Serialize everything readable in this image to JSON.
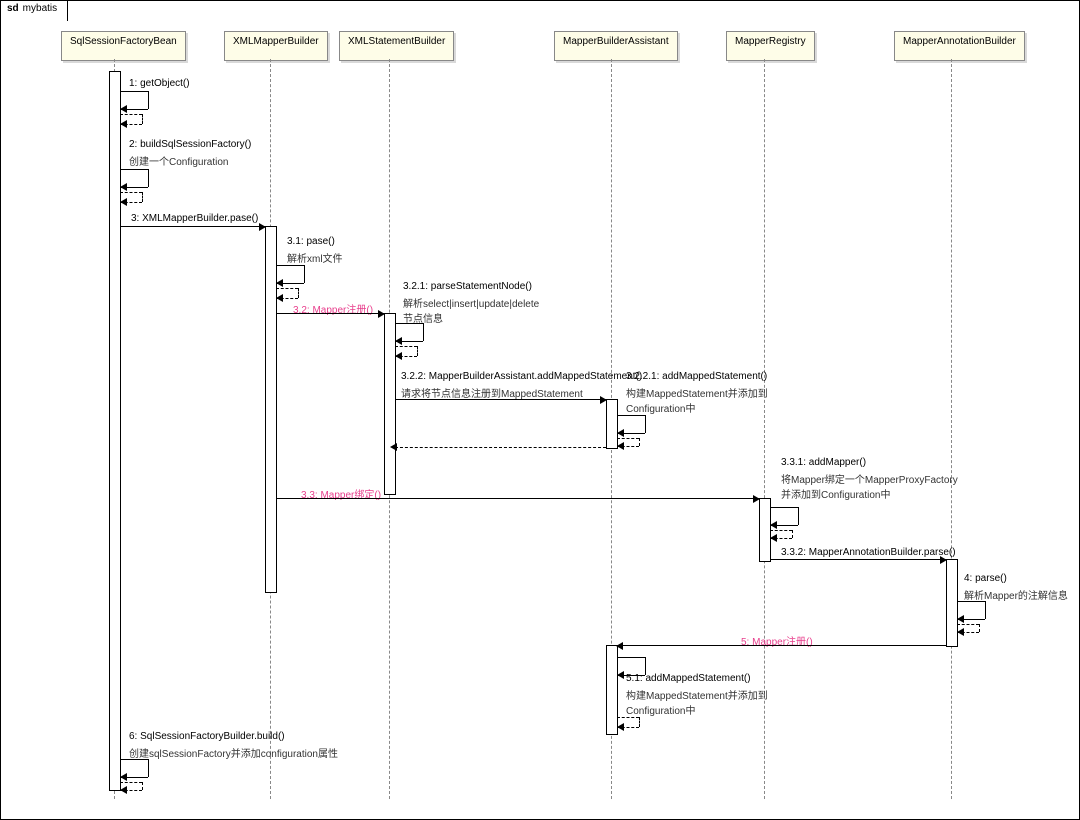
{
  "diagram": {
    "frame_kind": "sd",
    "frame_name": "mybatis",
    "participants": {
      "p1": "SqlSessionFactoryBean",
      "p2": "XMLMapperBuilder",
      "p3": "XMLStatementBuilder",
      "p4": "MapperBuilderAssistant",
      "p5": "MapperRegistry",
      "p6": "MapperAnnotationBuilder"
    },
    "messages": {
      "m1": "1: getObject()",
      "m2": "2: buildSqlSessionFactory()",
      "m2n": "创建一个Configuration",
      "m3": "3: XMLMapperBuilder.pase()",
      "m3_1": "3.1: pase()",
      "m3_1n": "解析xml文件",
      "m3_2": "3.2: Mapper注册()",
      "m3_2_1": "3.2.1: parseStatementNode()",
      "m3_2_1n": "解析select|insert|update|delete\n节点信息",
      "m3_2_2": "3.2.2: MapperBuilderAssistant.addMappedStatement()",
      "m3_2_2n": "请求将节点信息注册到MappedStatement",
      "m3_2_2_1": "3.2.2.1: addMappedStatement()",
      "m3_2_2_1n": "构建MappedStatement并添加到\nConfiguration中",
      "m3_3": "3.3: Mapper绑定()",
      "m3_3_1": "3.3.1: addMapper()",
      "m3_3_1n": "将Mapper绑定一个MapperProxyFactory\n并添加到Configuration中",
      "m3_3_2": "3.3.2: MapperAnnotationBuilder.parse()",
      "m4": "4: parse()",
      "m4n": "解析Mapper的注解信息",
      "m5": "5: Mapper注册()",
      "m5_1": "5.1: addMappedStatement()",
      "m5_1n": "构建MappedStatement并添加到\nConfiguration中",
      "m6": "6: SqlSessionFactoryBuilder.build()",
      "m6n": "创建sqlSessionFactory并添加configuration属性"
    }
  },
  "colors": {
    "accent": "#e83e8c",
    "participant_bg": "#fefde8"
  }
}
